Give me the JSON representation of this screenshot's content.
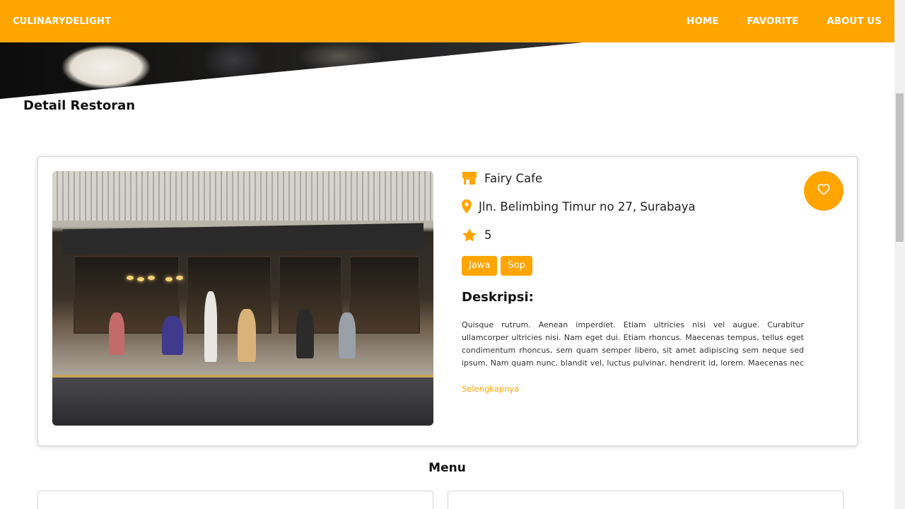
{
  "navbar": {
    "brand": "CULINARYDELIGHT",
    "links": [
      "HOME",
      "FAVORITE",
      "ABOUT US"
    ]
  },
  "page": {
    "section_title": "Detail Restoran"
  },
  "restaurant": {
    "name": "Fairy Cafe",
    "address": "Jln. Belimbing Timur no 27, Surabaya",
    "rating": "5",
    "categories": [
      "Jawa",
      "Sop"
    ],
    "description_title": "Deskripsi:",
    "description": "Quisque rutrum. Aenean imperdiet. Etiam ultricies nisi vel augue. Curabitur ullamcorper ultricies nisi. Nam eget dui. Etiam rhoncus. Maecenas tempus, tellus eget condimentum rhoncus, sem quam semper libero, sit amet adipiscing sem neque sed ipsum. Nam quam nunc, blandit vel, luctus pulvinar, hendrerit id, lorem. Maecenas nec odio et ant...",
    "read_more": "Selengkapnya"
  },
  "menu": {
    "title": "Menu"
  },
  "colors": {
    "accent": "#ffa500"
  },
  "icons": {
    "name": "store-icon",
    "address": "map-pin-icon",
    "rating": "star-icon",
    "favorite": "heart-outline-icon"
  }
}
